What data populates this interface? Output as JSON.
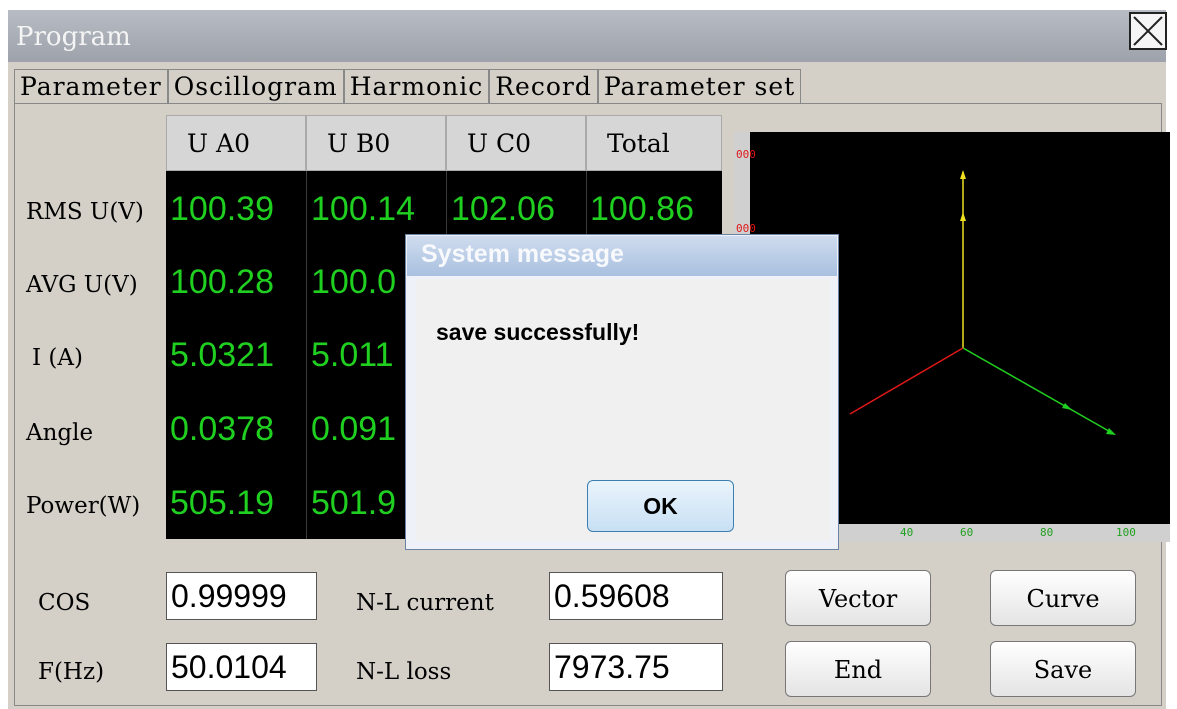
{
  "window": {
    "title": "Program"
  },
  "tabs": [
    "Parameter",
    "Oscillogram",
    "Harmonic",
    "Record",
    "Parameter set"
  ],
  "table": {
    "columns": [
      "U A0",
      "U B0",
      "U C0",
      "Total"
    ],
    "row_labels": [
      "RMS U(V)",
      "AVG U(V)",
      "I (A)",
      "Angle",
      "Power(W)"
    ],
    "rows": [
      [
        "100.39",
        "100.14",
        "102.06",
        "100.86"
      ],
      [
        "100.28",
        "100.0",
        "",
        ""
      ],
      [
        "5.0321",
        "5.011",
        "",
        ""
      ],
      [
        "0.0378",
        "0.091",
        "",
        ""
      ],
      [
        "505.19",
        "501.9",
        "",
        ""
      ]
    ]
  },
  "chart": {
    "x_ticks": [
      "40",
      "60",
      "80",
      "100"
    ],
    "y_ticks": [
      "000",
      "000"
    ],
    "colors": {
      "a": "#f0e020",
      "b": "#20d020",
      "c": "#e01818"
    }
  },
  "bottom": {
    "cos_label": "COS",
    "cos_value": "0.99999",
    "freq_label": "F(Hz)",
    "freq_value": "50.0104",
    "nl_current_label": "N-L current",
    "nl_current_value": "0.59608",
    "nl_loss_label": "N-L loss",
    "nl_loss_value": "7973.75"
  },
  "buttons": {
    "vector": "Vector",
    "curve": "Curve",
    "end": "End",
    "save": "Save"
  },
  "dialog": {
    "title": "System message",
    "message": "save successfully!",
    "ok": "OK"
  }
}
